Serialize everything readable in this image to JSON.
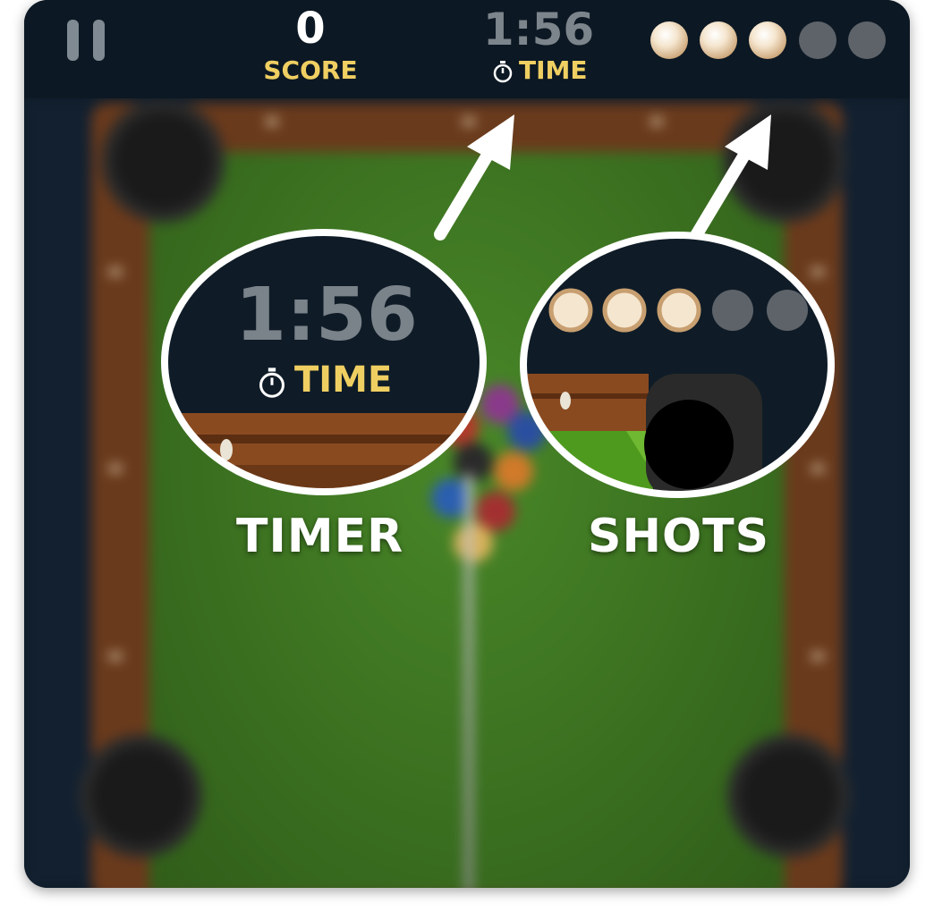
{
  "hud": {
    "score_value": "0",
    "score_label": "SCORE",
    "time_value": "1:56",
    "time_label": "TIME",
    "shots_total": 5,
    "shots_remaining": 3
  },
  "callouts": {
    "timer_label": "TIMER",
    "shots_label": "SHOTS",
    "magnified_time_value": "1:56",
    "magnified_time_label": "TIME"
  },
  "colors": {
    "hud_bg": "#0c1823",
    "accent_yellow": "#f0cf62",
    "felt_green": "#3f7a22",
    "rail_wood": "#6a3a1c"
  }
}
